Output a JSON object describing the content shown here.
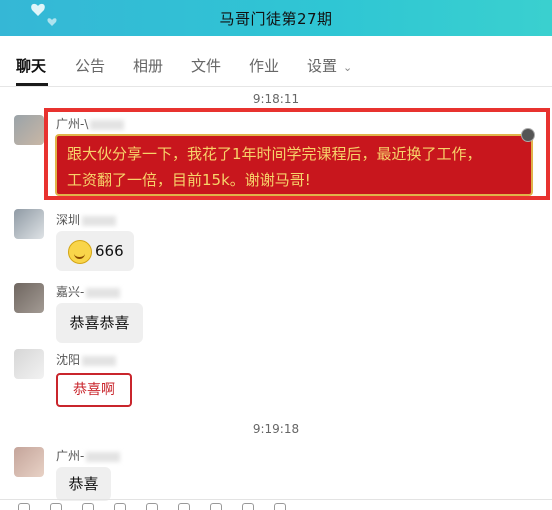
{
  "window": {
    "title": "马哥门徒第27期"
  },
  "tabs": [
    {
      "label": "聊天"
    },
    {
      "label": "公告"
    },
    {
      "label": "相册"
    },
    {
      "label": "文件"
    },
    {
      "label": "作业"
    },
    {
      "label": "设置"
    }
  ],
  "messages": {
    "ts1": "9:18:11",
    "m1": {
      "sender": "广州-\\",
      "text_line1": "跟大伙分享一下，我花了1年时间学完课程后，最近换了工作，",
      "text_line2": "工资翻了一倍，目前15k。谢谢马哥!"
    },
    "m2": {
      "sender": "深圳",
      "text": "666",
      "emoji": "smile-emoji"
    },
    "m3": {
      "sender": "嘉兴-",
      "text": "恭喜恭喜"
    },
    "m4": {
      "sender": "沈阳",
      "text": "恭喜啊"
    },
    "ts2": "9:19:18",
    "m5": {
      "sender": "广州-",
      "text": "恭喜"
    }
  },
  "colors": {
    "titlebar": "#35b7d6",
    "highlight": "#e8322f",
    "red_bubble": "#c8161d",
    "gold_text": "#f7d36a"
  }
}
